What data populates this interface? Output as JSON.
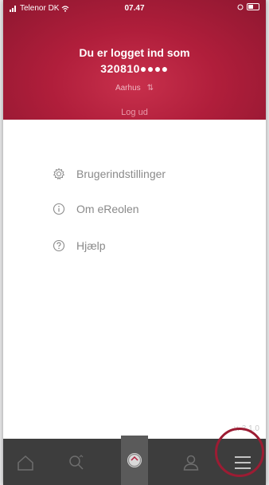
{
  "status": {
    "carrier": "Telenor DK",
    "time": "07.47"
  },
  "header": {
    "line1": "Du er logget ind som",
    "line2": "320810●●●●",
    "city": "Aarhus",
    "logout": "Log ud"
  },
  "menu": [
    {
      "label": "Brugerindstillinger",
      "icon": "gear-icon"
    },
    {
      "label": "Om eReolen",
      "icon": "info-icon"
    },
    {
      "label": "Hjælp",
      "icon": "help-icon"
    }
  ],
  "version": "v. 3.1.0",
  "tabs": [
    "home-icon",
    "search-icon",
    "app-logo",
    "user-icon",
    "hamburger-icon"
  ],
  "colors": {
    "brand": "#b01e3b",
    "tabbar": "#3d3d3d",
    "highlight": "#9c1c33"
  }
}
